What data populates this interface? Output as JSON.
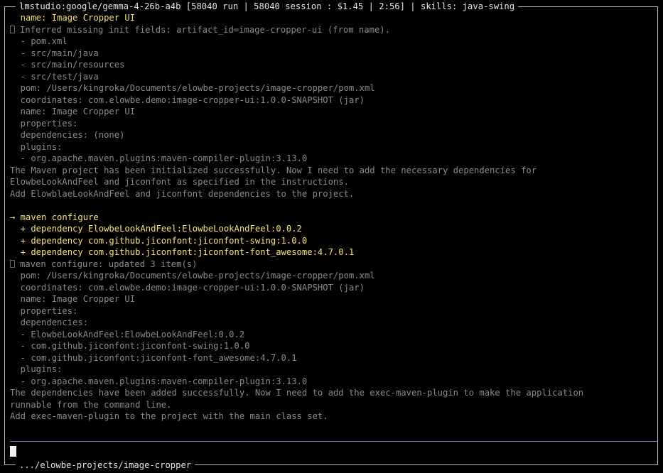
{
  "header": {
    "title": "lmstudio:google/gemma-4-26b-a4b [58040 run | 58040 session : $1.45 | 2:56] | skills: java-swing"
  },
  "footer": {
    "path": ".../elowbe-projects/image-cropper"
  },
  "log": {
    "l1": "  name: Image Cropper UI",
    "l2_rest": "Inferred missing init fields: artifact_id=image-cropper-ui (from name).",
    "l3": "  - pom.xml",
    "l4": "  - src/main/java",
    "l5": "  - src/main/resources",
    "l6": "  - src/test/java",
    "l7": "  pom: /Users/kingroka/Documents/elowbe-projects/image-cropper/pom.xml",
    "l8": "  coordinates: com.elowbe.demo:image-cropper-ui:1.0.0-SNAPSHOT (jar)",
    "l9": "  name: Image Cropper UI",
    "l10": "  properties:",
    "l11": "  dependencies: (none)",
    "l12": "  plugins:",
    "l13": "  - org.apache.maven.plugins:maven-compiler-plugin:3.13.0",
    "l14": "The Maven project has been initialized successfully. Now I need to add the necessary dependencies for",
    "l15": "ElowbeLookAndFeel and jiconfont as specified in the instructions.",
    "l16": "Add ElowblaeLookAndFeel and jiconfont dependencies to the project.",
    "l17": "",
    "l18_arrow": "→",
    "l18_rest": " maven configure",
    "l19": "  + dependency ElowbeLookAndFeel:ElowbeLookAndFeel:0.0.2",
    "l20": "  + dependency com.github.jiconfont:jiconfont-swing:1.0.0",
    "l21": "  + dependency com.github.jiconfont:jiconfont-font_awesome:4.7.0.1",
    "l22_rest": "maven configure: updated 3 item(s)",
    "l23": "  pom: /Users/kingroka/Documents/elowbe-projects/image-cropper/pom.xml",
    "l24": "  coordinates: com.elowbe.demo:image-cropper-ui:1.0.0-SNAPSHOT (jar)",
    "l25": "  name: Image Cropper UI",
    "l26": "  properties:",
    "l27": "  dependencies:",
    "l28": "  - ElowbeLookAndFeel:ElowbeLookAndFeel:0.0.2",
    "l29": "  - com.github.jiconfont:jiconfont-swing:1.0.0",
    "l30": "  - com.github.jiconfont:jiconfont-font_awesome:4.7.0.1",
    "l31": "  plugins:",
    "l32": "  - org.apache.maven.plugins:maven-compiler-plugin:3.13.0",
    "l33": "The dependencies have been added successfully. Now I need to add the exec-maven-plugin to make the application",
    "l34": "runnable from the command line.",
    "l35": "Add exec-maven-plugin to the project with the main class set."
  },
  "input": {
    "value": ""
  },
  "colors": {
    "background": "#000000",
    "frame": "#bdbdbd",
    "highlight": "#f5e07a",
    "divider": "#7a5fc4",
    "text": "#a8a8a8"
  }
}
